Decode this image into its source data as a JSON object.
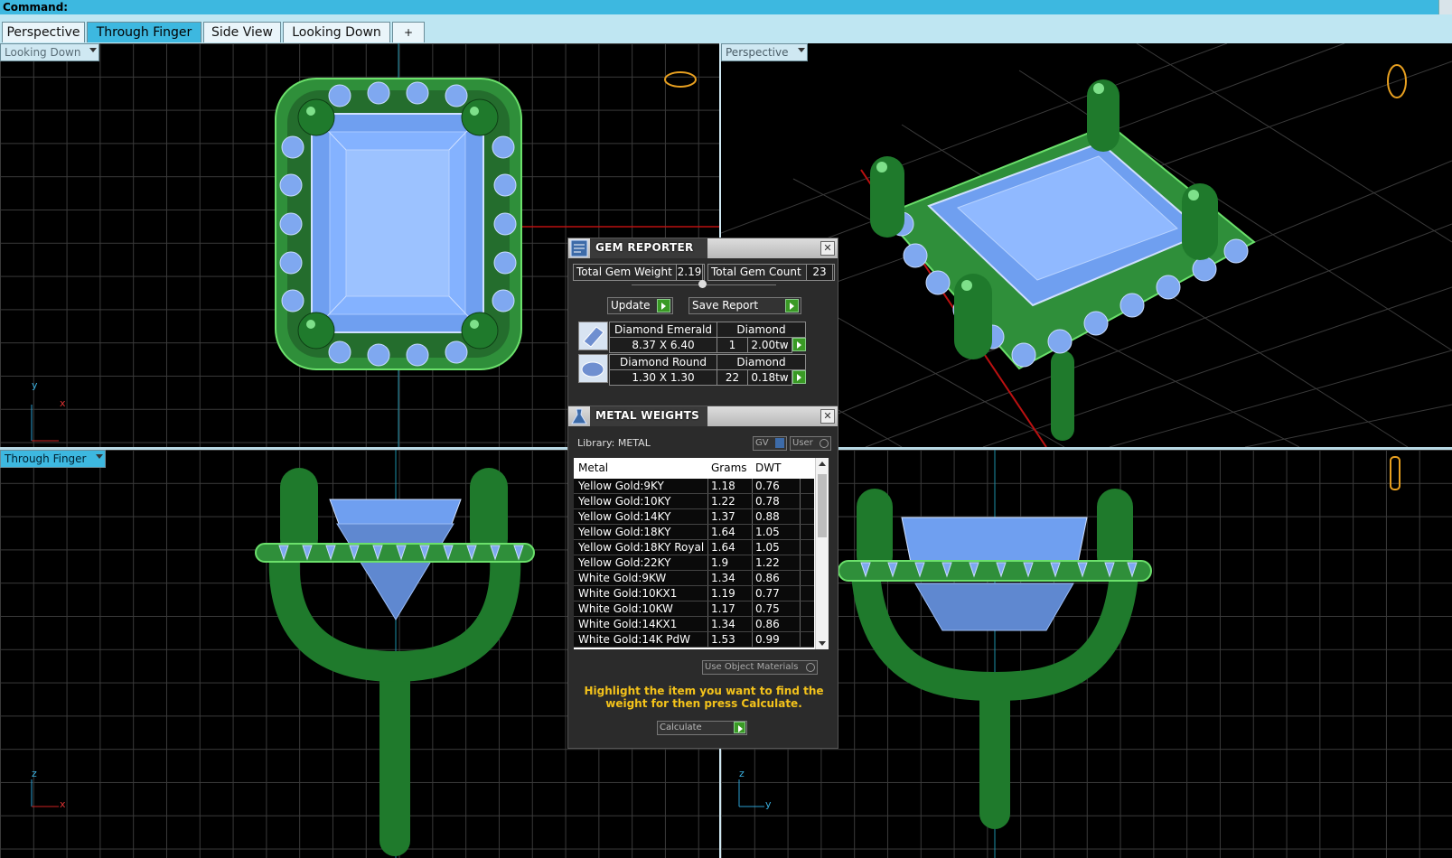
{
  "command": {
    "label": "Command:"
  },
  "tabs": [
    {
      "label": "Perspective"
    },
    {
      "label": "Through Finger"
    },
    {
      "label": "Side View"
    },
    {
      "label": "Looking Down"
    },
    {
      "label": "+"
    }
  ],
  "viewports": {
    "top_left": {
      "label": "Looking Down",
      "axis_a": "y",
      "axis_b": "x"
    },
    "top_right": {
      "label": "Perspective"
    },
    "bottom_left": {
      "label": "Through Finger",
      "axis_a": "z",
      "axis_b": "x"
    },
    "bottom_right": {
      "axis_a": "z",
      "axis_b": "y"
    }
  },
  "gem_reporter": {
    "title": "GEM REPORTER",
    "total_weight_label": "Total Gem Weight",
    "total_weight": "2.19",
    "total_count_label": "Total Gem Count",
    "total_count": "23",
    "update_label": "Update",
    "save_label": "Save Report",
    "gems": [
      {
        "name": "Diamond Emerald",
        "material": "Diamond",
        "size": "8.37 X 6.40",
        "count": "1",
        "weight": "2.00tw"
      },
      {
        "name": "Diamond Round",
        "material": "Diamond",
        "size": "1.30 X 1.30",
        "count": "22",
        "weight": "0.18tw"
      }
    ]
  },
  "metal_weights": {
    "title": "METAL WEIGHTS",
    "library": "Library: METAL",
    "gv_label": "GV",
    "user_label": "User",
    "columns": [
      "Metal",
      "Grams",
      "DWT"
    ],
    "rows": [
      [
        "Yellow Gold:9KY",
        "1.18",
        "0.76"
      ],
      [
        "Yellow Gold:10KY",
        "1.22",
        "0.78"
      ],
      [
        "Yellow Gold:14KY",
        "1.37",
        "0.88"
      ],
      [
        "Yellow Gold:18KY",
        "1.64",
        "1.05"
      ],
      [
        "Yellow Gold:18KY Royal",
        "1.64",
        "1.05"
      ],
      [
        "Yellow Gold:22KY",
        "1.9",
        "1.22"
      ],
      [
        "White Gold:9KW",
        "1.34",
        "0.86"
      ],
      [
        "White Gold:10KX1",
        "1.19",
        "0.77"
      ],
      [
        "White Gold:10KW",
        "1.17",
        "0.75"
      ],
      [
        "White Gold:14KX1",
        "1.34",
        "0.86"
      ],
      [
        "White Gold:14K PdW",
        "1.53",
        "0.99"
      ]
    ],
    "use_object_label": "Use Object Materials",
    "hint": "Highlight the item you want to find the weight for then press Calculate.",
    "calculate_label": "Calculate"
  }
}
